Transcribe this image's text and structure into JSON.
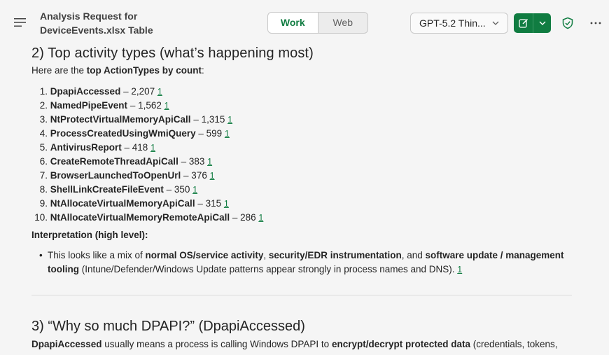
{
  "header": {
    "title_line1": "Analysis Request for",
    "title_line2": "DeviceEvents.xlsx Table",
    "toggle": {
      "work": "Work",
      "web": "Web"
    },
    "model": "GPT-5.2 Thin...",
    "accent": "#107c41"
  },
  "section2": {
    "heading": "2) Top activity types (what’s happening most)",
    "intro_prefix": "Here are the ",
    "intro_bold": "top ActionTypes by count",
    "intro_suffix": ":",
    "items": [
      {
        "num": "1.",
        "name": "DpapiAccessed",
        "count": " – 2,207 ",
        "cite": "1"
      },
      {
        "num": "2.",
        "name": "NamedPipeEvent",
        "count": " – 1,562 ",
        "cite": "1"
      },
      {
        "num": "3.",
        "name": "NtProtectVirtualMemoryApiCall",
        "count": " – 1,315 ",
        "cite": "1"
      },
      {
        "num": "4.",
        "name": "ProcessCreatedUsingWmiQuery",
        "count": " – 599 ",
        "cite": "1"
      },
      {
        "num": "5.",
        "name": "AntivirusReport",
        "count": " – 418 ",
        "cite": "1"
      },
      {
        "num": "6.",
        "name": "CreateRemoteThreadApiCall",
        "count": " – 383 ",
        "cite": "1"
      },
      {
        "num": "7.",
        "name": "BrowserLaunchedToOpenUrl",
        "count": " – 376 ",
        "cite": "1"
      },
      {
        "num": "8.",
        "name": "ShellLinkCreateFileEvent",
        "count": " – 350 ",
        "cite": "1"
      },
      {
        "num": "9.",
        "name": "NtAllocateVirtualMemoryApiCall",
        "count": " – 315 ",
        "cite": "1"
      },
      {
        "num": "10.",
        "name": "NtAllocateVirtualMemoryRemoteApiCall",
        "count": " – 286 ",
        "cite": "1"
      }
    ],
    "interp_heading": "Interpretation (high level):",
    "bullet": {
      "t1": "This looks like a mix of ",
      "b1": "normal OS/service activity",
      "t2": ", ",
      "b2": "security/EDR instrumentation",
      "t3": ", and ",
      "b3": "software update / management tooling",
      "t4": " (Intune/Defender/Windows Update patterns appear strongly in process names and DNS). ",
      "cite": "1"
    }
  },
  "section3": {
    "heading": "3) “Why so much DPAPI?” (DpapiAccessed)",
    "p_bold1": "DpapiAccessed",
    "p_t1": " usually means a process is calling Windows DPAPI to ",
    "p_bold2": "encrypt/decrypt protected data",
    "p_t2": " (credentials, tokens,"
  }
}
